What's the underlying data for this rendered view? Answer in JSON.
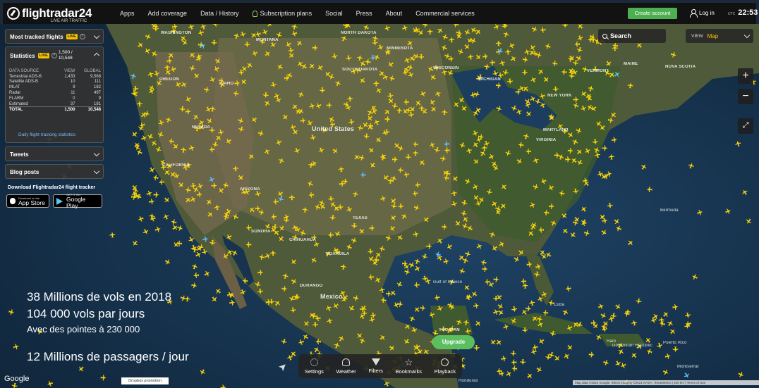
{
  "brand": {
    "name": "flightradar24",
    "tagline": "LIVE AIR TRAFFIC"
  },
  "nav": [
    "Apps",
    "Add coverage",
    "Data / History",
    "Subscription plans",
    "Social",
    "Press",
    "About",
    "Commercial services"
  ],
  "header": {
    "create_account": "Create account",
    "login": "Log in",
    "utc_label": "UTC",
    "time": "22:53"
  },
  "most_tracked": {
    "title": "Most tracked flights",
    "badge": "LIVE"
  },
  "statistics": {
    "title": "Statistics",
    "badge": "LIVE",
    "summary_visible": "1,500 /",
    "summary_total": "10,548",
    "columns": [
      "DATA SOURCE",
      "VIEW",
      "GLOBAL"
    ],
    "rows": [
      [
        "Terrestrial ADS-B",
        "1,433",
        "9,568"
      ],
      [
        "Satellite ADS-B",
        "10",
        "111"
      ],
      [
        "MLAT",
        "9",
        "182"
      ],
      [
        "Radar",
        "11",
        "497"
      ],
      [
        "FLARM",
        "0",
        "9"
      ],
      [
        "Estimated",
        "37",
        "181"
      ]
    ],
    "total": [
      "TOTAL",
      "1,500",
      "10,548"
    ],
    "link": "Daily flight tracking statistics"
  },
  "tweets": {
    "title": "Tweets"
  },
  "blog": {
    "title": "Blog posts"
  },
  "download": {
    "title": "Download Flightradar24 flight tracker",
    "appstore_small": "Download on the",
    "appstore": "App Store",
    "gplay_small": "GET IT ON",
    "gplay": "Google Play"
  },
  "search": {
    "label": "Search"
  },
  "view": {
    "label": "VIEW",
    "value": "Map"
  },
  "map_controls": {
    "zoom_in": "+",
    "zoom_out": "−"
  },
  "overlay": {
    "line1": "38 Millions de vols en 2018",
    "line2": "104 000 vols par jours",
    "line3": "Avec des pointes à 230 000",
    "line4": "12 Millions de passagers / jour"
  },
  "toolbar": {
    "settings": "Settings",
    "weather": "Weather",
    "filters": "Filters",
    "bookmarks": "Bookmarks",
    "playback": "Playback"
  },
  "upgrade": "Upgrade",
  "footer": {
    "google": "Google",
    "dropbox": "Dropbox promotion",
    "attribution": "Map data ©2021 Google, INEGI Imagery ©2021 NASA, TerraMetrics | 200 km | Terms of Use"
  },
  "map_labels": {
    "washington": "WASHINGTON",
    "montana": "MONTANA",
    "north_dakota": "NORTH DAKOTA",
    "minnesota": "MINNESOTA",
    "south_dakota": "SOUTH DAKOTA",
    "wisconsin": "WISCONSIN",
    "michigan": "MICHIGAN",
    "oregon": "OREGON",
    "idaho": "IDAHO",
    "nevada": "NEVADA",
    "california": "CALIFORNIA",
    "arizona": "ARIZONA",
    "texas": "TEXAS",
    "united_states": "United States",
    "mexico": "Mexico",
    "vermont": "VERMONT",
    "maine": "MAINE",
    "nova_scotia": "NOVA SCOTIA",
    "new_york": "NEW YORK",
    "maryland": "MARYLAND",
    "virginia": "VIRGINIA",
    "bermuda": "Bermuda",
    "cuba": "Cuba",
    "haiti": "Haiti",
    "sonora": "SONORA",
    "chihuahua": "CHIHUAHUA",
    "coahuila": "COAHUILA",
    "durango": "DURANGO",
    "gulf_mexico": "Gulf of Mexico",
    "yucatan": "YUCATAN",
    "dominican": "Dominican Republic",
    "puerto_rico": "Puerto Rico",
    "montserrat": "Montserrat",
    "honduras": "Honduras"
  },
  "colors": {
    "plane": "#f6d20a",
    "accent": "#f6c400",
    "create": "#4caf50"
  }
}
